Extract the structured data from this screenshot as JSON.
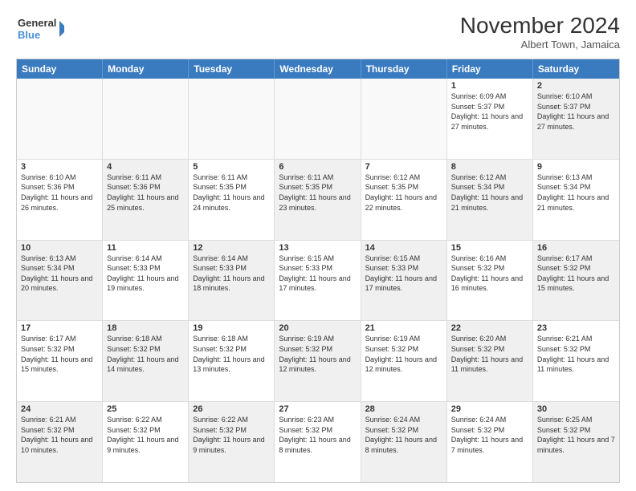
{
  "logo": {
    "line1": "General",
    "line2": "Blue"
  },
  "title": "November 2024",
  "location": "Albert Town, Jamaica",
  "days_of_week": [
    "Sunday",
    "Monday",
    "Tuesday",
    "Wednesday",
    "Thursday",
    "Friday",
    "Saturday"
  ],
  "weeks": [
    [
      {
        "day": "",
        "empty": true
      },
      {
        "day": "",
        "empty": true
      },
      {
        "day": "",
        "empty": true
      },
      {
        "day": "",
        "empty": true
      },
      {
        "day": "",
        "empty": true
      },
      {
        "day": "1",
        "sunrise": "Sunrise: 6:09 AM",
        "sunset": "Sunset: 5:37 PM",
        "daylight": "Daylight: 11 hours and 27 minutes."
      },
      {
        "day": "2",
        "sunrise": "Sunrise: 6:10 AM",
        "sunset": "Sunset: 5:37 PM",
        "daylight": "Daylight: 11 hours and 27 minutes.",
        "shaded": true
      }
    ],
    [
      {
        "day": "3",
        "sunrise": "Sunrise: 6:10 AM",
        "sunset": "Sunset: 5:36 PM",
        "daylight": "Daylight: 11 hours and 26 minutes."
      },
      {
        "day": "4",
        "sunrise": "Sunrise: 6:11 AM",
        "sunset": "Sunset: 5:36 PM",
        "daylight": "Daylight: 11 hours and 25 minutes.",
        "shaded": true
      },
      {
        "day": "5",
        "sunrise": "Sunrise: 6:11 AM",
        "sunset": "Sunset: 5:35 PM",
        "daylight": "Daylight: 11 hours and 24 minutes."
      },
      {
        "day": "6",
        "sunrise": "Sunrise: 6:11 AM",
        "sunset": "Sunset: 5:35 PM",
        "daylight": "Daylight: 11 hours and 23 minutes.",
        "shaded": true
      },
      {
        "day": "7",
        "sunrise": "Sunrise: 6:12 AM",
        "sunset": "Sunset: 5:35 PM",
        "daylight": "Daylight: 11 hours and 22 minutes."
      },
      {
        "day": "8",
        "sunrise": "Sunrise: 6:12 AM",
        "sunset": "Sunset: 5:34 PM",
        "daylight": "Daylight: 11 hours and 21 minutes.",
        "shaded": true
      },
      {
        "day": "9",
        "sunrise": "Sunrise: 6:13 AM",
        "sunset": "Sunset: 5:34 PM",
        "daylight": "Daylight: 11 hours and 21 minutes."
      }
    ],
    [
      {
        "day": "10",
        "sunrise": "Sunrise: 6:13 AM",
        "sunset": "Sunset: 5:34 PM",
        "daylight": "Daylight: 11 hours and 20 minutes.",
        "shaded": true
      },
      {
        "day": "11",
        "sunrise": "Sunrise: 6:14 AM",
        "sunset": "Sunset: 5:33 PM",
        "daylight": "Daylight: 11 hours and 19 minutes."
      },
      {
        "day": "12",
        "sunrise": "Sunrise: 6:14 AM",
        "sunset": "Sunset: 5:33 PM",
        "daylight": "Daylight: 11 hours and 18 minutes.",
        "shaded": true
      },
      {
        "day": "13",
        "sunrise": "Sunrise: 6:15 AM",
        "sunset": "Sunset: 5:33 PM",
        "daylight": "Daylight: 11 hours and 17 minutes."
      },
      {
        "day": "14",
        "sunrise": "Sunrise: 6:15 AM",
        "sunset": "Sunset: 5:33 PM",
        "daylight": "Daylight: 11 hours and 17 minutes.",
        "shaded": true
      },
      {
        "day": "15",
        "sunrise": "Sunrise: 6:16 AM",
        "sunset": "Sunset: 5:32 PM",
        "daylight": "Daylight: 11 hours and 16 minutes."
      },
      {
        "day": "16",
        "sunrise": "Sunrise: 6:17 AM",
        "sunset": "Sunset: 5:32 PM",
        "daylight": "Daylight: 11 hours and 15 minutes.",
        "shaded": true
      }
    ],
    [
      {
        "day": "17",
        "sunrise": "Sunrise: 6:17 AM",
        "sunset": "Sunset: 5:32 PM",
        "daylight": "Daylight: 11 hours and 15 minutes."
      },
      {
        "day": "18",
        "sunrise": "Sunrise: 6:18 AM",
        "sunset": "Sunset: 5:32 PM",
        "daylight": "Daylight: 11 hours and 14 minutes.",
        "shaded": true
      },
      {
        "day": "19",
        "sunrise": "Sunrise: 6:18 AM",
        "sunset": "Sunset: 5:32 PM",
        "daylight": "Daylight: 11 hours and 13 minutes."
      },
      {
        "day": "20",
        "sunrise": "Sunrise: 6:19 AM",
        "sunset": "Sunset: 5:32 PM",
        "daylight": "Daylight: 11 hours and 12 minutes.",
        "shaded": true
      },
      {
        "day": "21",
        "sunrise": "Sunrise: 6:19 AM",
        "sunset": "Sunset: 5:32 PM",
        "daylight": "Daylight: 11 hours and 12 minutes."
      },
      {
        "day": "22",
        "sunrise": "Sunrise: 6:20 AM",
        "sunset": "Sunset: 5:32 PM",
        "daylight": "Daylight: 11 hours and 11 minutes.",
        "shaded": true
      },
      {
        "day": "23",
        "sunrise": "Sunrise: 6:21 AM",
        "sunset": "Sunset: 5:32 PM",
        "daylight": "Daylight: 11 hours and 11 minutes."
      }
    ],
    [
      {
        "day": "24",
        "sunrise": "Sunrise: 6:21 AM",
        "sunset": "Sunset: 5:32 PM",
        "daylight": "Daylight: 11 hours and 10 minutes.",
        "shaded": true
      },
      {
        "day": "25",
        "sunrise": "Sunrise: 6:22 AM",
        "sunset": "Sunset: 5:32 PM",
        "daylight": "Daylight: 11 hours and 9 minutes."
      },
      {
        "day": "26",
        "sunrise": "Sunrise: 6:22 AM",
        "sunset": "Sunset: 5:32 PM",
        "daylight": "Daylight: 11 hours and 9 minutes.",
        "shaded": true
      },
      {
        "day": "27",
        "sunrise": "Sunrise: 6:23 AM",
        "sunset": "Sunset: 5:32 PM",
        "daylight": "Daylight: 11 hours and 8 minutes."
      },
      {
        "day": "28",
        "sunrise": "Sunrise: 6:24 AM",
        "sunset": "Sunset: 5:32 PM",
        "daylight": "Daylight: 11 hours and 8 minutes.",
        "shaded": true
      },
      {
        "day": "29",
        "sunrise": "Sunrise: 6:24 AM",
        "sunset": "Sunset: 5:32 PM",
        "daylight": "Daylight: 11 hours and 7 minutes."
      },
      {
        "day": "30",
        "sunrise": "Sunrise: 6:25 AM",
        "sunset": "Sunset: 5:32 PM",
        "daylight": "Daylight: 11 hours and 7 minutes.",
        "shaded": true
      }
    ]
  ]
}
